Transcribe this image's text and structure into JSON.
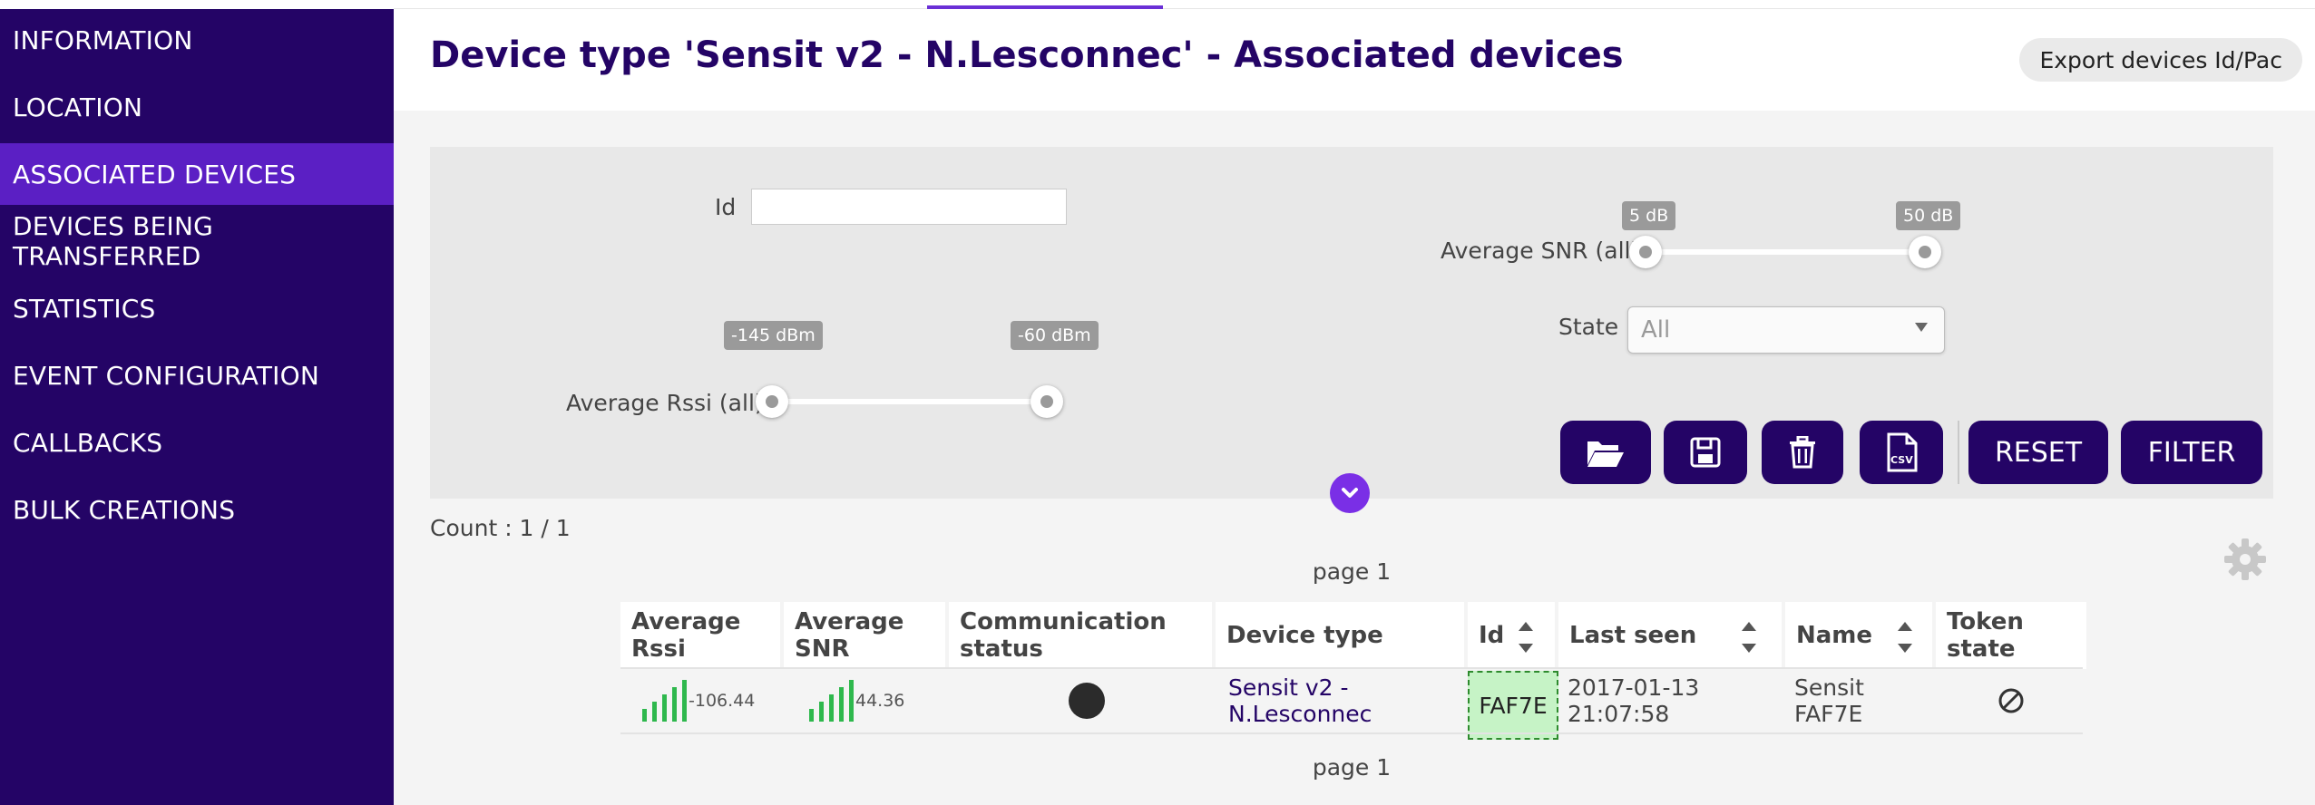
{
  "sidebar": {
    "items": [
      {
        "label": "INFORMATION"
      },
      {
        "label": "LOCATION"
      },
      {
        "label": "ASSOCIATED DEVICES",
        "active": true
      },
      {
        "label": "DEVICES BEING TRANSFERRED"
      },
      {
        "label": "STATISTICS"
      },
      {
        "label": "EVENT CONFIGURATION"
      },
      {
        "label": "CALLBACKS"
      },
      {
        "label": "BULK CREATIONS"
      }
    ]
  },
  "header": {
    "title": "Device type 'Sensit v2 - N.Lesconnec' - Associated devices",
    "export_label": "Export devices Id/Pac"
  },
  "filters": {
    "id_label": "Id",
    "id_value": "",
    "rssi_label": "Average Rssi (all)",
    "rssi_min_label": "-145 dBm",
    "rssi_max_label": "-60 dBm",
    "snr_label": "Average SNR (all)",
    "snr_min_label": "5 dB",
    "snr_max_label": "50 dB",
    "state_label": "State",
    "state_value": "All",
    "reset_label": "RESET",
    "filter_label": "FILTER",
    "csv_label": "CSV"
  },
  "results": {
    "count": "Count : 1 / 1",
    "page_top": "page 1",
    "page_bottom": "page 1"
  },
  "table": {
    "columns": [
      "Average Rssi",
      "Average SNR",
      "Communication status",
      "Device type",
      "Id",
      "Last seen",
      "Name",
      "Token state"
    ],
    "rows": [
      {
        "rssi": "-106.44",
        "snr": "44.36",
        "device_type": "Sensit v2 - N.Lesconnec",
        "id": "FAF7E",
        "last_seen": "2017-01-13 21:07:58",
        "name": "Sensit FAF7E"
      }
    ]
  },
  "colors": {
    "sidebar_bg": "#240466",
    "sidebar_active": "#5b1fc4",
    "accent": "#7a2fe6",
    "signal_green": "#2eb84d",
    "id_highlight": "#c6f3c6"
  }
}
